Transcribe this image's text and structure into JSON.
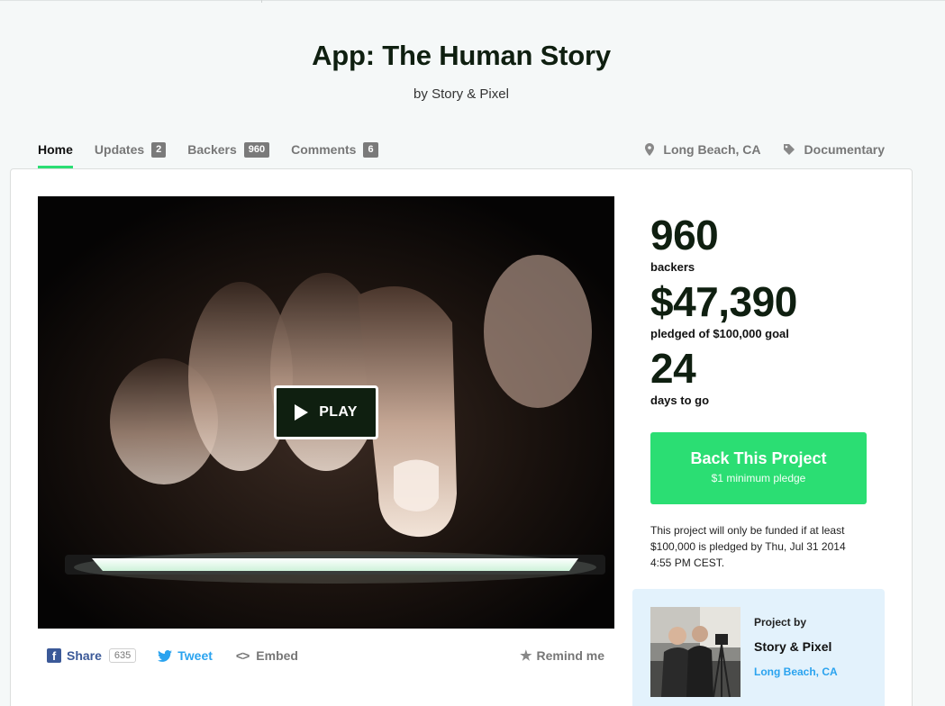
{
  "project": {
    "title": "App: The Human Story",
    "byline_prefix": "by",
    "creator": "Story & Pixel"
  },
  "tabs": [
    {
      "label": "Home",
      "active": true
    },
    {
      "label": "Updates",
      "count": "2"
    },
    {
      "label": "Backers",
      "count": "960"
    },
    {
      "label": "Comments",
      "count": "6"
    }
  ],
  "meta": {
    "location": "Long Beach, CA",
    "category": "Documentary",
    "location_icon": "map-pin-icon",
    "category_icon": "tag-icon"
  },
  "video": {
    "play_label": "PLAY"
  },
  "share": {
    "facebook_label": "Share",
    "facebook_count": "635",
    "tweet_label": "Tweet",
    "embed_label": "Embed",
    "remind_label": "Remind me"
  },
  "stats": {
    "backers_value": "960",
    "backers_label": "backers",
    "pledged_value": "$47,390",
    "pledged_label": "pledged of $100,000 goal",
    "days_value": "24",
    "days_label": "days to go"
  },
  "back_button": {
    "label": "Back This Project",
    "sublabel": "$1 minimum pledge"
  },
  "funding_note": "This project will only be funded if at least $100,000 is pledged by Thu, Jul 31 2014 4:55 PM CEST.",
  "creator_box": {
    "heading": "Project by",
    "name": "Story & Pixel",
    "location": "Long Beach, CA"
  },
  "colors": {
    "accent_green": "#2bde73",
    "title_dark": "#0f1f10",
    "link_blue": "#2aa3ef",
    "facebook_blue": "#3b5998",
    "creator_box_bg": "#e3f2fc"
  }
}
